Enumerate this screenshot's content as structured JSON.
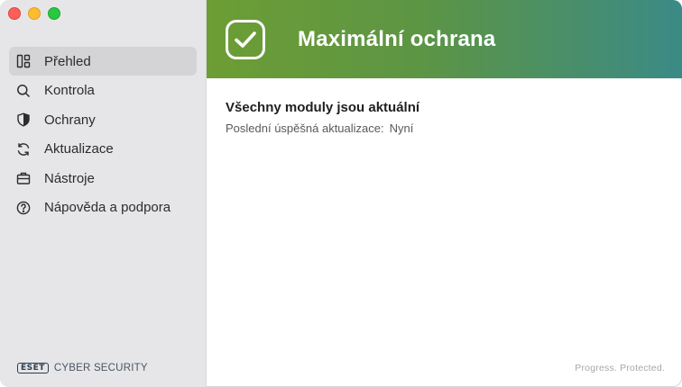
{
  "window": {
    "controls": [
      "close",
      "minimize",
      "maximize"
    ]
  },
  "sidebar": {
    "items": [
      {
        "label": "Přehled",
        "icon": "dashboard-icon",
        "active": true
      },
      {
        "label": "Kontrola",
        "icon": "search-icon",
        "active": false
      },
      {
        "label": "Ochrany",
        "icon": "shield-icon",
        "active": false
      },
      {
        "label": "Aktualizace",
        "icon": "refresh-icon",
        "active": false
      },
      {
        "label": "Nástroje",
        "icon": "toolbox-icon",
        "active": false
      },
      {
        "label": "Nápověda a podpora",
        "icon": "help-icon",
        "active": false
      }
    ],
    "brand": {
      "logo": "ESET",
      "text": "CYBER SECURITY"
    }
  },
  "banner": {
    "title": "Maximální ochrana",
    "icon": "checkmark-icon",
    "gradient": [
      "#6d9d34",
      "#3b8a86"
    ]
  },
  "status": {
    "title": "Všechny moduly jsou aktuální",
    "last_update_label": "Poslední úspěšná aktualizace:",
    "last_update_value": "Nyní"
  },
  "footer": {
    "tagline": "Progress. Protected."
  }
}
